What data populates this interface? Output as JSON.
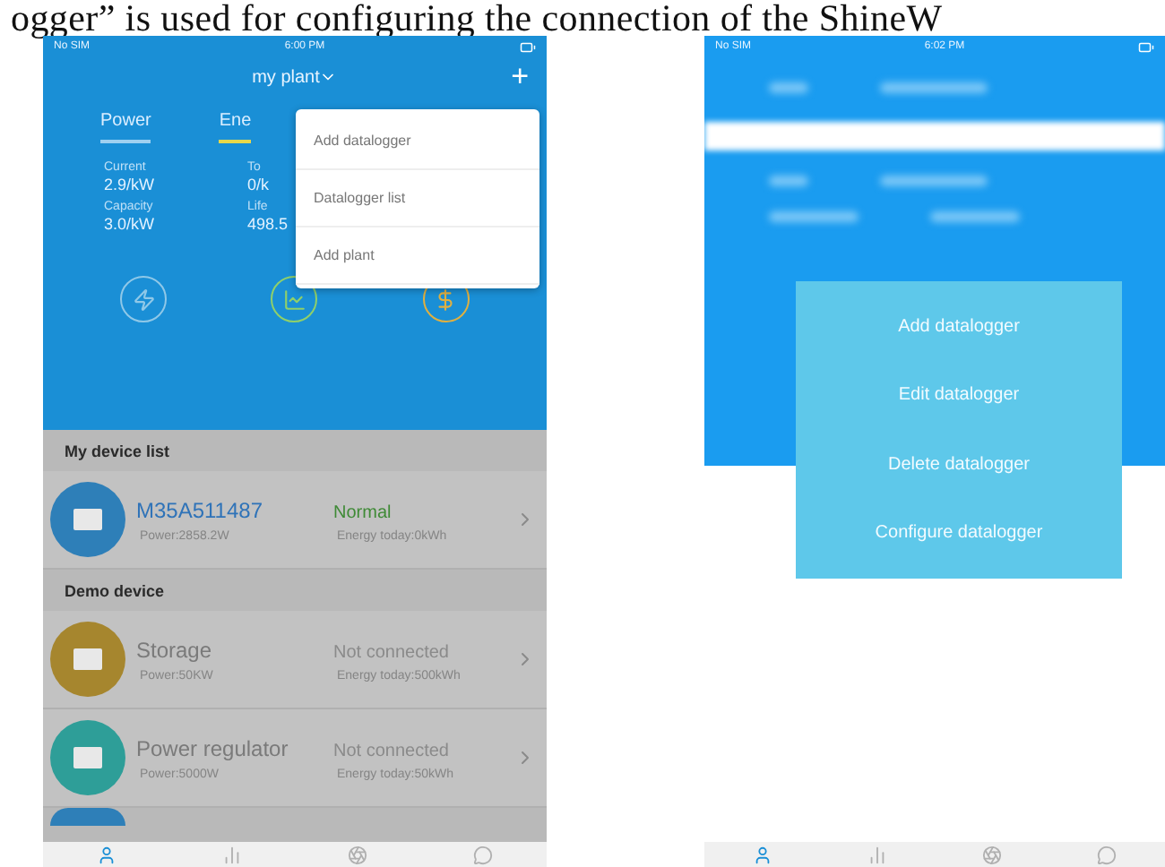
{
  "caption": "ogger” is used for configuring the connection of the ShineW",
  "left_phone": {
    "status_bar": {
      "carrier": "No SIM",
      "time": "6:00 PM"
    },
    "header": {
      "title": "my plant",
      "add": "+"
    },
    "tabs": [
      {
        "label": "Power",
        "selected": false
      },
      {
        "label": "Ene",
        "selected": true
      }
    ],
    "stats": [
      {
        "label": "Current",
        "value": "2.9/kW"
      },
      {
        "label": "To",
        "value": "0/k"
      },
      {
        "label": "Capacity",
        "value": "3.0/kW"
      },
      {
        "label": "Life",
        "value": "498.5"
      }
    ],
    "summary_icons": [
      {
        "kind": "power",
        "color": "#8fc8e8"
      },
      {
        "kind": "chart",
        "color": "#8fd06a"
      },
      {
        "kind": "money",
        "color": "#e0b040"
      }
    ],
    "menu": [
      "Add datalogger",
      "Datalogger list",
      "Add plant"
    ],
    "sections": [
      {
        "title": "My device list",
        "devices": [
          {
            "kind": "online",
            "name": "M35A511487",
            "status": "Normal",
            "power": "Power:2858.2W",
            "energy": "Energy today:0kWh",
            "color": "#2e7fb8"
          }
        ]
      },
      {
        "title": "Demo device",
        "devices": [
          {
            "kind": "offline",
            "name": "Storage",
            "status": "Not connected",
            "power": "Power:50KW",
            "energy": "Energy today:500kWh",
            "color": "#a6862e"
          },
          {
            "kind": "offline",
            "name": "Power regulator",
            "status": "Not connected",
            "power": "Power:5000W",
            "energy": "Energy today:50kWh",
            "color": "#2e9e98"
          }
        ]
      }
    ],
    "tab_bar": [
      {
        "kind": "person",
        "selected": true
      },
      {
        "kind": "chart",
        "selected": false
      },
      {
        "kind": "dial",
        "selected": false
      },
      {
        "kind": "chat",
        "selected": false
      }
    ]
  },
  "right_phone": {
    "status_bar": {
      "carrier": "No SIM",
      "time": "6:02 PM"
    },
    "action_sheet": [
      "Add datalogger",
      "Edit datalogger",
      "Delete datalogger",
      "Configure datalogger"
    ],
    "tab_bar": [
      {
        "kind": "person",
        "selected": true
      },
      {
        "kind": "chart",
        "selected": false
      },
      {
        "kind": "dial",
        "selected": false
      },
      {
        "kind": "chat",
        "selected": false
      }
    ]
  }
}
